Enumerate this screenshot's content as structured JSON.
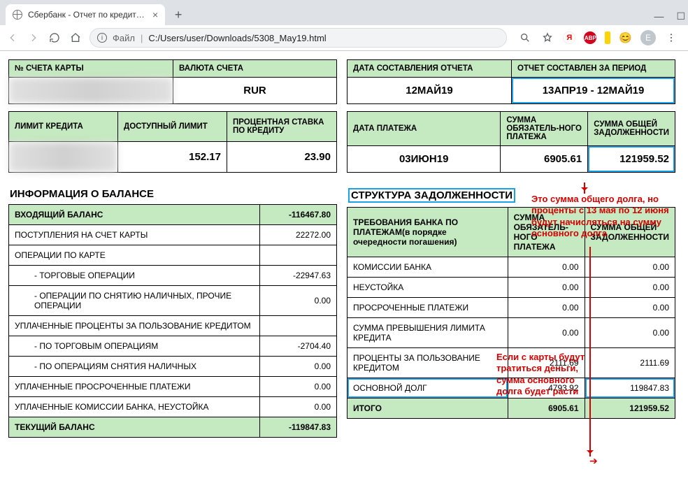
{
  "browser": {
    "tab_title": "Сбербанк - Отчет по кредитно…",
    "file_label": "Файл",
    "path_prefix": "C:/Users/user/Downloads/",
    "path_file": "5308_May19.html",
    "avatar_letter": "E"
  },
  "top1": {
    "left": {
      "h1": "№ СЧЕТА КАРТЫ",
      "h2": "ВАЛЮТА СЧЕТА",
      "v1": " ",
      "v2": "RUR"
    },
    "right": {
      "h1": "ДАТА СОСТАВЛЕНИЯ ОТЧЕТА",
      "h2": "ОТЧЕТ СОСТАВЛЕН ЗА ПЕРИОД",
      "v1": "12МАЙ19",
      "v2": "13АПР19 - 12МАЙ19"
    }
  },
  "top2": {
    "left": {
      "h1": "ЛИМИТ КРЕДИТА",
      "h2": "ДОСТУПНЫЙ ЛИМИТ",
      "h3": "ПРОЦЕНТНАЯ СТАВКА ПО КРЕДИТУ",
      "v1": " ",
      "v2": "152.17",
      "v3": "23.90"
    },
    "right": {
      "h1": "ДАТА ПЛАТЕЖА",
      "h2": "СУММА ОБЯЗАТЕЛЬ-НОГО ПЛАТЕЖА",
      "h3": "СУММА ОБЩЕЙ ЗАДОЛЖЕННОСТИ",
      "v1": "03ИЮН19",
      "v2": "6905.61",
      "v3": "121959.52"
    }
  },
  "balance": {
    "title": "ИНФОРМАЦИЯ О БАЛАНСЕ",
    "rows": [
      {
        "label": "ВХОДЯЩИЙ БАЛАНС",
        "value": "-116467.80",
        "cls": "h"
      },
      {
        "label": "ПОСТУПЛЕНИЯ НА СЧЕТ КАРТЫ",
        "value": "22272.00"
      },
      {
        "label": "ОПЕРАЦИИ ПО КАРТЕ",
        "value": ""
      },
      {
        "label": "- ТОРГОВЫЕ ОПЕРАЦИИ",
        "value": "-22947.63",
        "indent": true
      },
      {
        "label": "- ОПЕРАЦИИ ПО СНЯТИЮ НАЛИЧНЫХ, ПРОЧИЕ ОПЕРАЦИИ",
        "value": "0.00",
        "indent": true
      },
      {
        "label": "УПЛАЧЕННЫЕ ПРОЦЕНТЫ ЗА ПОЛЬЗОВАНИЕ КРЕДИТОМ",
        "value": ""
      },
      {
        "label": "- ПО ТОРГОВЫМ ОПЕРАЦИЯМ",
        "value": "-2704.40",
        "indent": true
      },
      {
        "label": "- ПО ОПЕРАЦИЯМ СНЯТИЯ НАЛИЧНЫХ",
        "value": "0.00",
        "indent": true
      },
      {
        "label": "УПЛАЧЕННЫЕ ПРОСРОЧЕННЫЕ ПЛАТЕЖИ",
        "value": "0.00"
      },
      {
        "label": "УПЛАЧЕННЫЕ КОМИССИИ БАНКА, НЕУСТОЙКА",
        "value": "0.00"
      },
      {
        "label": "ТЕКУЩИЙ БАЛАНС",
        "value": "-119847.83",
        "cls": "h"
      }
    ]
  },
  "debt": {
    "title": "СТРУКТУРА ЗАДОЛЖЕННОСТИ",
    "head": {
      "c1": "ТРЕБОВАНИЯ БАНКА ПО ПЛАТЕЖАМ",
      "c1_sub": "(в порядке очередности погашения)",
      "c2": "СУММА ОБЯЗАТЕЛЬ-НОГО ПЛАТЕЖА",
      "c3": "СУММА ОБЩЕЙ ЗАДОЛЖЕННОСТИ"
    },
    "rows": [
      {
        "label": "КОМИССИИ БАНКА",
        "v1": "0.00",
        "v2": "0.00"
      },
      {
        "label": "НЕУСТОЙКА",
        "v1": "0.00",
        "v2": "0.00"
      },
      {
        "label": "ПРОСРОЧЕННЫЕ ПЛАТЕЖИ",
        "v1": "0.00",
        "v2": "0.00"
      },
      {
        "label": "СУММА ПРЕВЫШЕНИЯ ЛИМИТА КРЕДИТА",
        "v1": "0.00",
        "v2": "0.00"
      },
      {
        "label": "ПРОЦЕНТЫ ЗА ПОЛЬЗОВАНИЕ КРЕДИТОМ",
        "v1": "2111.69",
        "v2": "2111.69"
      },
      {
        "label": "ОСНОВНОЙ ДОЛГ",
        "v1": "4793.92",
        "v2": "119847.83",
        "mark": true
      }
    ],
    "total": {
      "label": "ИТОГО",
      "v1": "6905.61",
      "v2": "121959.52"
    }
  },
  "annotations": {
    "a1": "Это сумма общего долга, но проценты с 13 мая по 12 июня будут начисляться на сумму основного долга",
    "a2": "Если с карты будут тратиться деньги, сумма основного долга будет расти"
  }
}
